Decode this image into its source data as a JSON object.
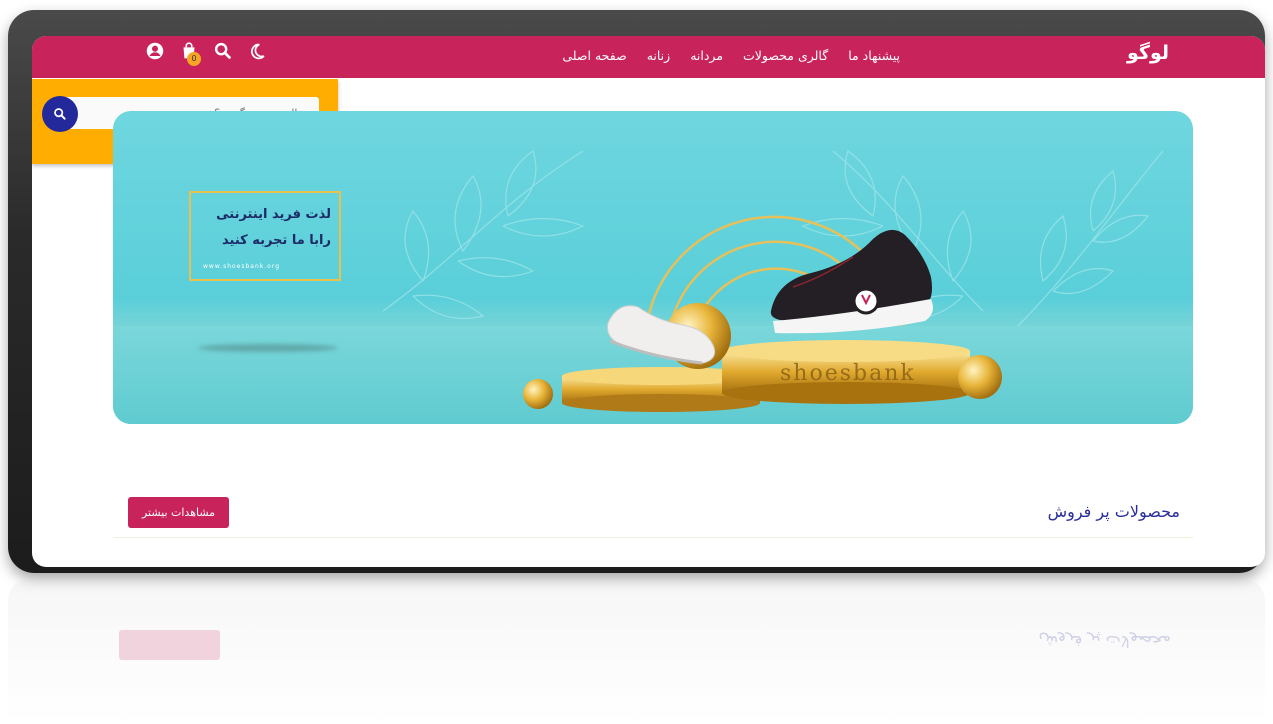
{
  "header": {
    "logo": "لوگو",
    "nav": [
      {
        "label": "صفحه اصلی"
      },
      {
        "label": "زنانه"
      },
      {
        "label": "مردانه"
      },
      {
        "label": "گالری محصولات"
      },
      {
        "label": "پیشنهاد ما"
      }
    ],
    "icons": [
      "user-icon",
      "cart-icon",
      "search-icon",
      "moon-icon"
    ],
    "cart_count": "0"
  },
  "search": {
    "placeholder": "دنبال چی می گردی؟"
  },
  "banner": {
    "promo_line1": "لذت فرید اینترنتی",
    "promo_line2": "رابا ما تجربه کنید",
    "promo_url": "www.shoesbank.org",
    "brand": "shoesbank"
  },
  "section": {
    "title": "محصولات پر فروش",
    "more_label": "مشاهدات بیشتر"
  },
  "colors": {
    "brand": "#c8235a",
    "accent": "#ffad00",
    "banner": "#5acfd9",
    "heading": "#2b2f9b"
  }
}
